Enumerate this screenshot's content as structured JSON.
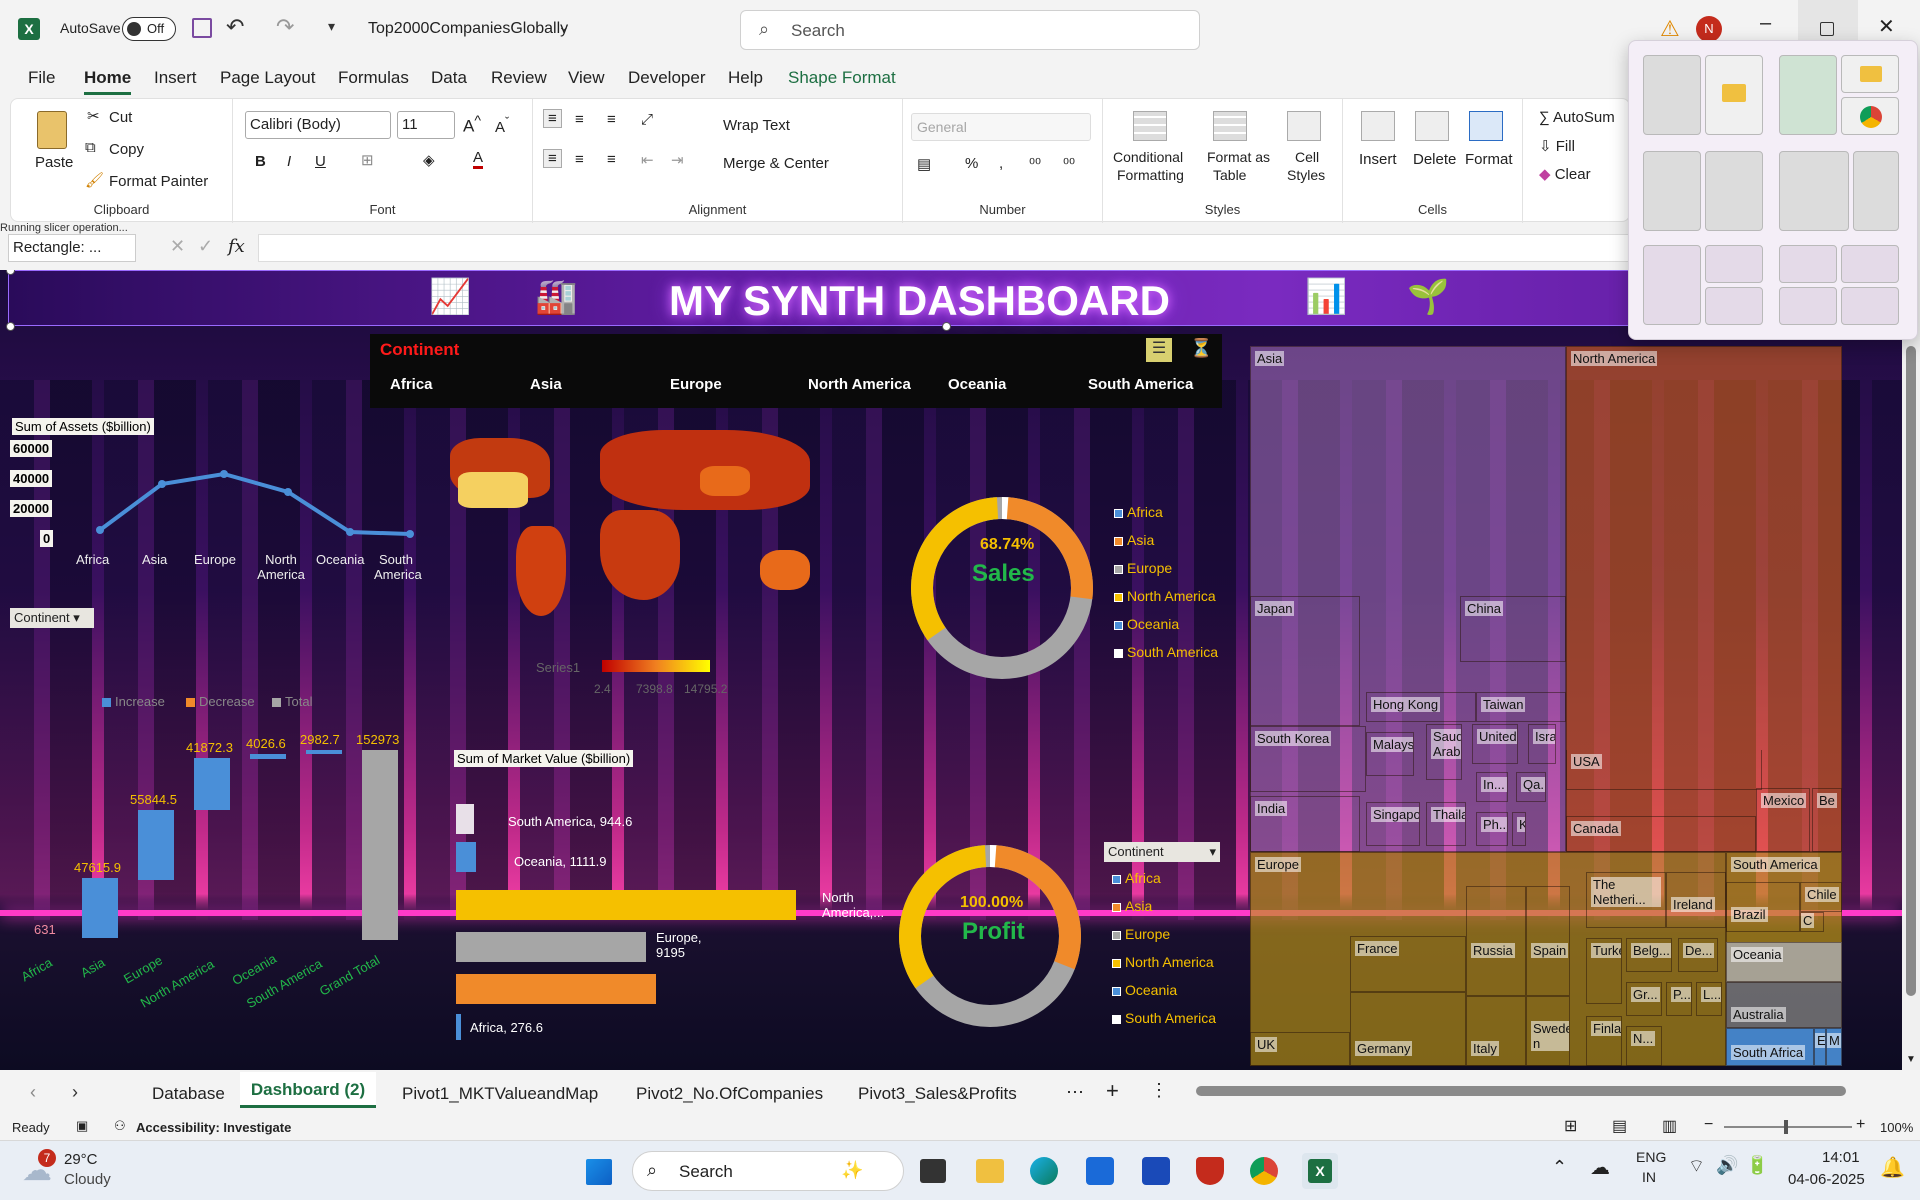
{
  "titlebar": {
    "autosave": "AutoSave",
    "toggle": "Off",
    "filename": "Top2000CompaniesGlobally",
    "search_placeholder": "Search",
    "avatar": "N"
  },
  "tabs": [
    "File",
    "Home",
    "Insert",
    "Page Layout",
    "Formulas",
    "Data",
    "Review",
    "View",
    "Developer",
    "Help",
    "Shape Format"
  ],
  "ribbon": {
    "clipboard": {
      "label": "Clipboard",
      "paste": "Paste",
      "cut": "Cut",
      "copy": "Copy",
      "painter": "Format Painter"
    },
    "font": {
      "label": "Font",
      "family": "Calibri (Body)",
      "size": "11"
    },
    "alignment": {
      "label": "Alignment",
      "wrap": "Wrap Text",
      "merge": "Merge & Center"
    },
    "number": {
      "label": "Number",
      "format": "General"
    },
    "styles": {
      "label": "Styles",
      "cond": "Conditional",
      "cond2": "Formatting",
      "fmt_table": "Format as",
      "fmt_table2": "Table",
      "cell_styles": "Cell",
      "cell_styles2": "Styles"
    },
    "cells": {
      "label": "Cells",
      "insert": "Insert",
      "delete": "Delete",
      "format": "Format"
    },
    "editing": {
      "autosum": "AutoSum",
      "fill": "Fill",
      "clear": "Clear"
    }
  },
  "formula": {
    "name_box": "Rectangle: ...",
    "fx": "fx",
    "tooltip": "Running slicer operation..."
  },
  "dashboard": {
    "title": "MY SYNTH DASHBOARD",
    "slicer": {
      "title": "Continent",
      "items": [
        "Africa",
        "Asia",
        "Europe",
        "North America",
        "Oceania",
        "South America"
      ]
    },
    "assets_chart": {
      "label": "Sum of Assets ($billion)",
      "yticks": [
        "60000",
        "40000",
        "20000",
        "0"
      ],
      "categories": [
        "Africa",
        "Asia",
        "Europe",
        "North America",
        "Oceania",
        "South America"
      ],
      "filter": "Continent"
    },
    "map_legend": {
      "series": "Series1",
      "min": "2.4",
      "mid": "7398.8",
      "max": "14795.2"
    },
    "waterfall": {
      "legend": [
        "Increase",
        "Decrease",
        "Total"
      ],
      "labels": [
        "631",
        "47615.9",
        "55844.5",
        "41872.3",
        "4026.6",
        "2982.7",
        "152973"
      ],
      "categories": [
        "Africa",
        "Asia",
        "Europe",
        "North America",
        "Oceania",
        "South America",
        "Grand Total"
      ]
    },
    "market_chart": {
      "label": "Sum of Market Value ($billion)",
      "bars": [
        "South America, 944.6",
        "Oceania, 1111.9",
        "North America,...",
        "Europe, 9195",
        "Africa, 276.6"
      ]
    },
    "sales_donut": {
      "pct": "68.74%",
      "label": "Sales"
    },
    "profit_donut": {
      "pct": "100.00%",
      "label": "Profit"
    },
    "donut_legend": [
      "Africa",
      "Asia",
      "Europe",
      "North America",
      "Oceania",
      "South America"
    ],
    "donut_filter": "Continent",
    "treemap": [
      "Asia",
      "North America",
      "Japan",
      "China",
      "South Korea",
      "Hong Kong",
      "Taiwan",
      "Malaysia",
      "Saudi Arabia",
      "United...",
      "Israel",
      "India",
      "Singapore",
      "Thailand",
      "In...",
      "Qa...",
      "Ph...",
      "K",
      "USA",
      "Canada",
      "Mexico",
      "Be",
      "Europe",
      "UK",
      "France",
      "Germany",
      "Russia",
      "Spain",
      "Italy",
      "The Netheri...",
      "Ireland",
      "Belg...",
      "De...",
      "Turkey",
      "Finland",
      "Gr...",
      "P...",
      "L...",
      "N...",
      "Swede n",
      "South America",
      "Brazil",
      "Chile",
      "C",
      "Oceania",
      "Australia",
      "South Africa",
      "E",
      "M"
    ]
  },
  "sheet_tabs": [
    "Database",
    "Dashboard (2)",
    "Pivot1_MKTValueandMap",
    "Pivot2_No.OfCompanies",
    "Pivot3_Sales&Profits"
  ],
  "status": {
    "ready": "Ready",
    "access": "Accessibility: Investigate",
    "zoom": "100%"
  },
  "taskbar": {
    "temp": "29°C",
    "weather": "Cloudy",
    "badge": "7",
    "search": "Search",
    "lang1": "ENG",
    "lang2": "IN",
    "time": "14:01",
    "date": "04-06-2025"
  },
  "colors": {
    "excel": "#1d6f42",
    "accent": "#e34ae0",
    "africa": "#4a8fd8",
    "orange": "#f08a2a",
    "yellow": "#f5c000",
    "gray": "#a6a6a6"
  }
}
